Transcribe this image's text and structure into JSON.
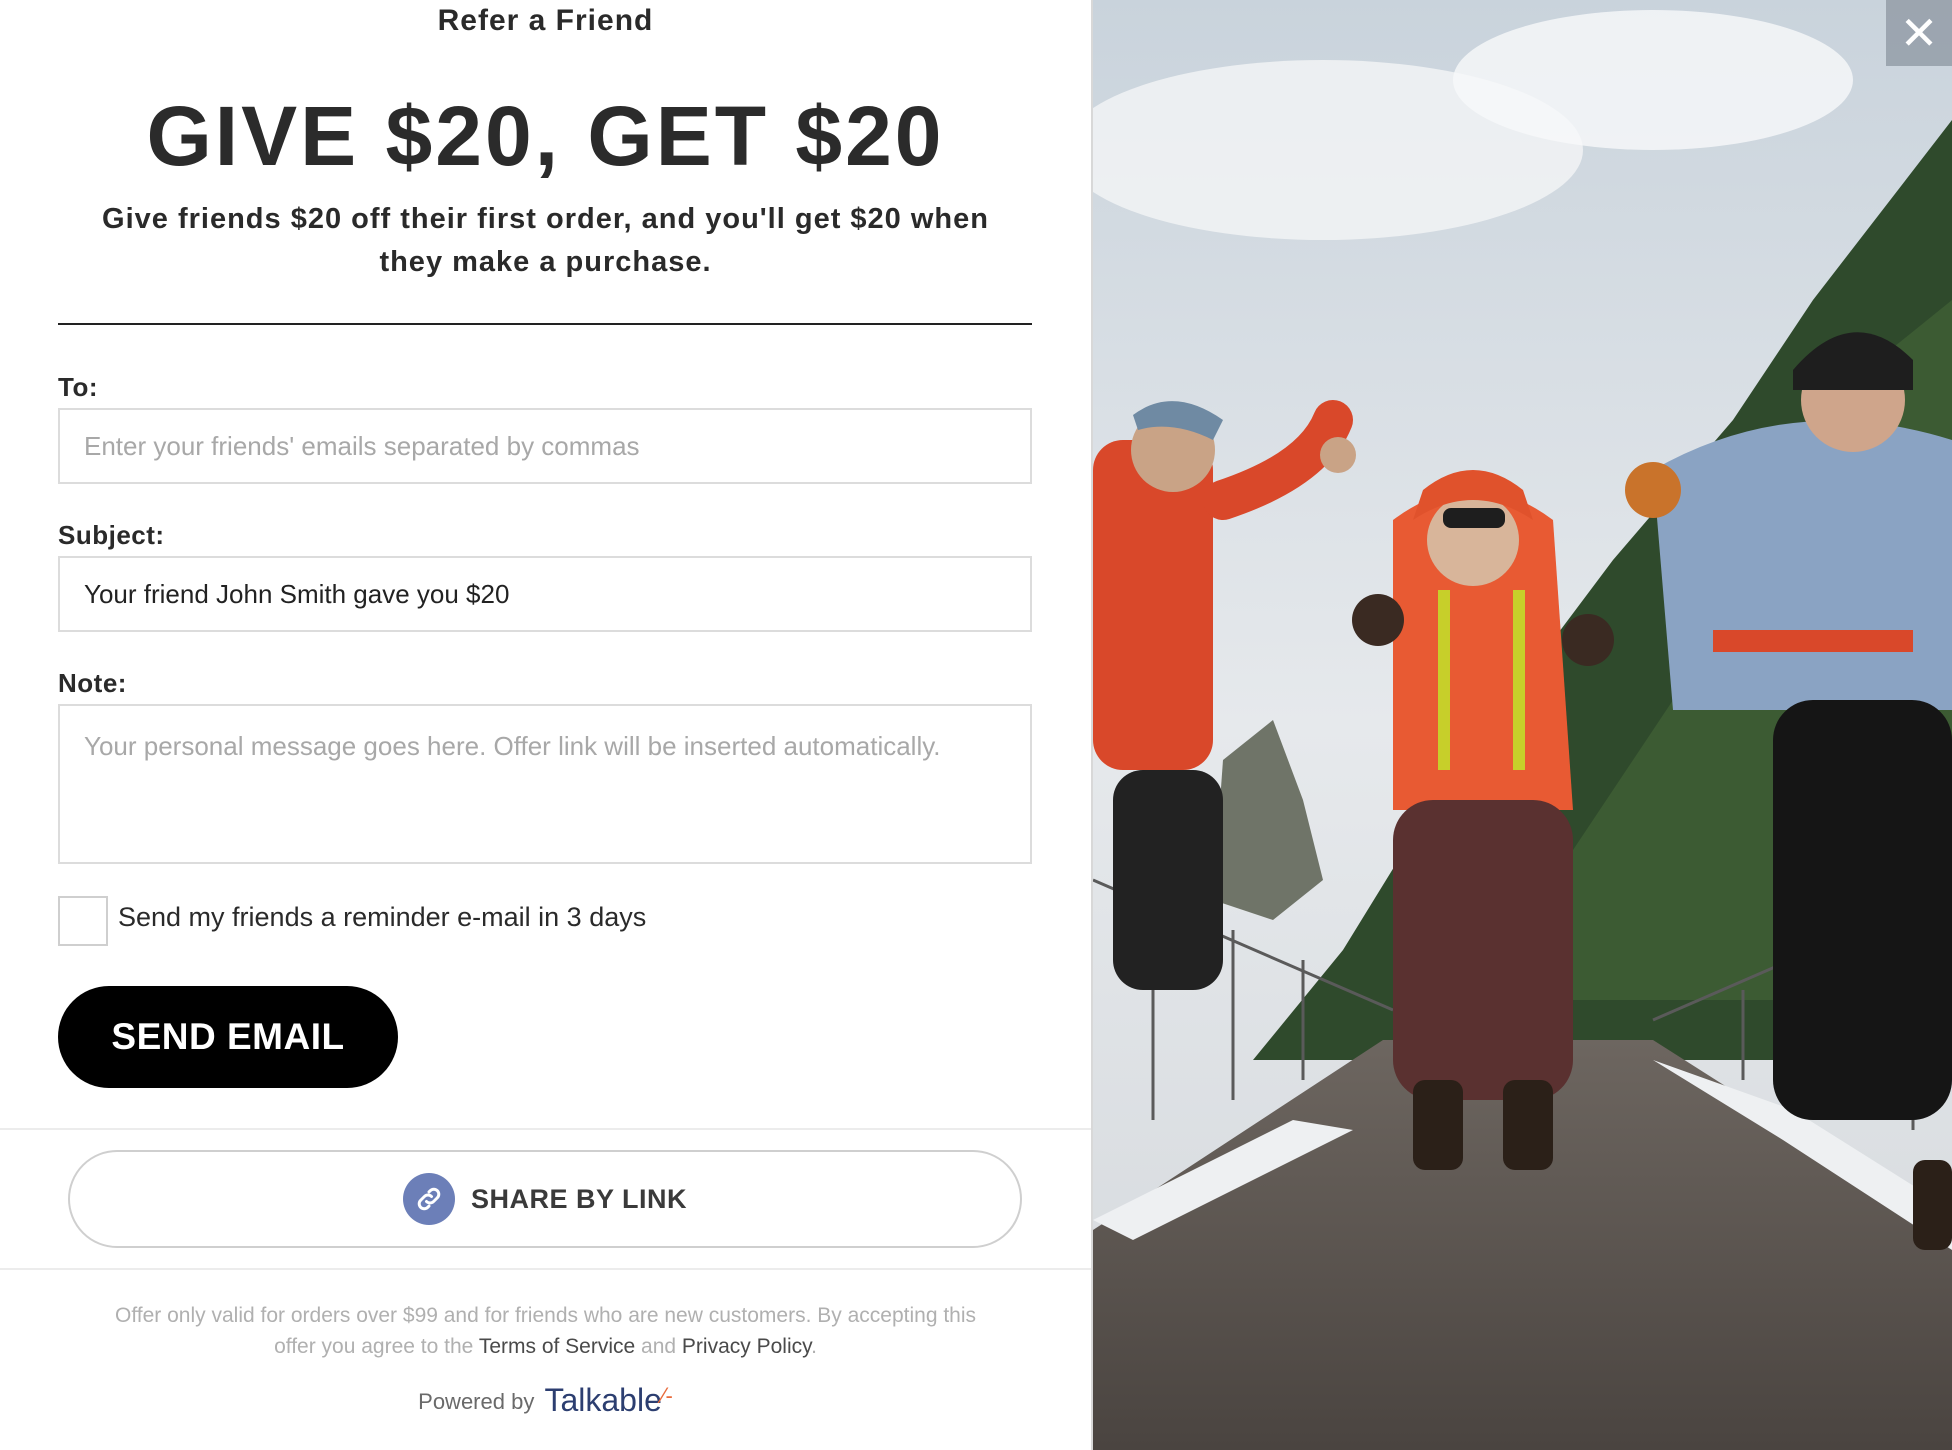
{
  "header": {
    "kicker": "Refer a Friend",
    "headline": "GIVE $20, GET $20",
    "subhead": "Give friends $20 off their first order, and you'll get $20 when they make a purchase."
  },
  "form": {
    "to_label": "To:",
    "to_placeholder": "Enter your friends' emails separated by commas",
    "subject_label": "Subject:",
    "subject_value": "Your friend John Smith gave you $20",
    "note_label": "Note:",
    "note_placeholder": "Your personal message goes here. Offer link will be inserted automatically.",
    "reminder_label": "Send my friends a reminder e-mail in 3 days",
    "reminder_checked": false,
    "send_label": "SEND EMAIL"
  },
  "share": {
    "label": "SHARE BY LINK",
    "icon": "link-icon"
  },
  "legal": {
    "text_1": "Offer only valid for orders over $99 and for friends who are new customers. By accepting this offer you agree to the",
    "terms": "Terms of Service",
    "and": "and",
    "privacy": "Privacy Policy",
    "period": "."
  },
  "footer": {
    "powered_by": "Powered by",
    "brand": "Talkable"
  },
  "photo": {
    "description_icon": "hikers-jumping-photo"
  },
  "close": {
    "glyph": "✕",
    "icon": "close-icon"
  },
  "colors": {
    "button_bg": "#000000",
    "link_icon_bg": "#6c7fb8",
    "brand": "#2c3e70",
    "brand_accent": "#e86a3a"
  }
}
